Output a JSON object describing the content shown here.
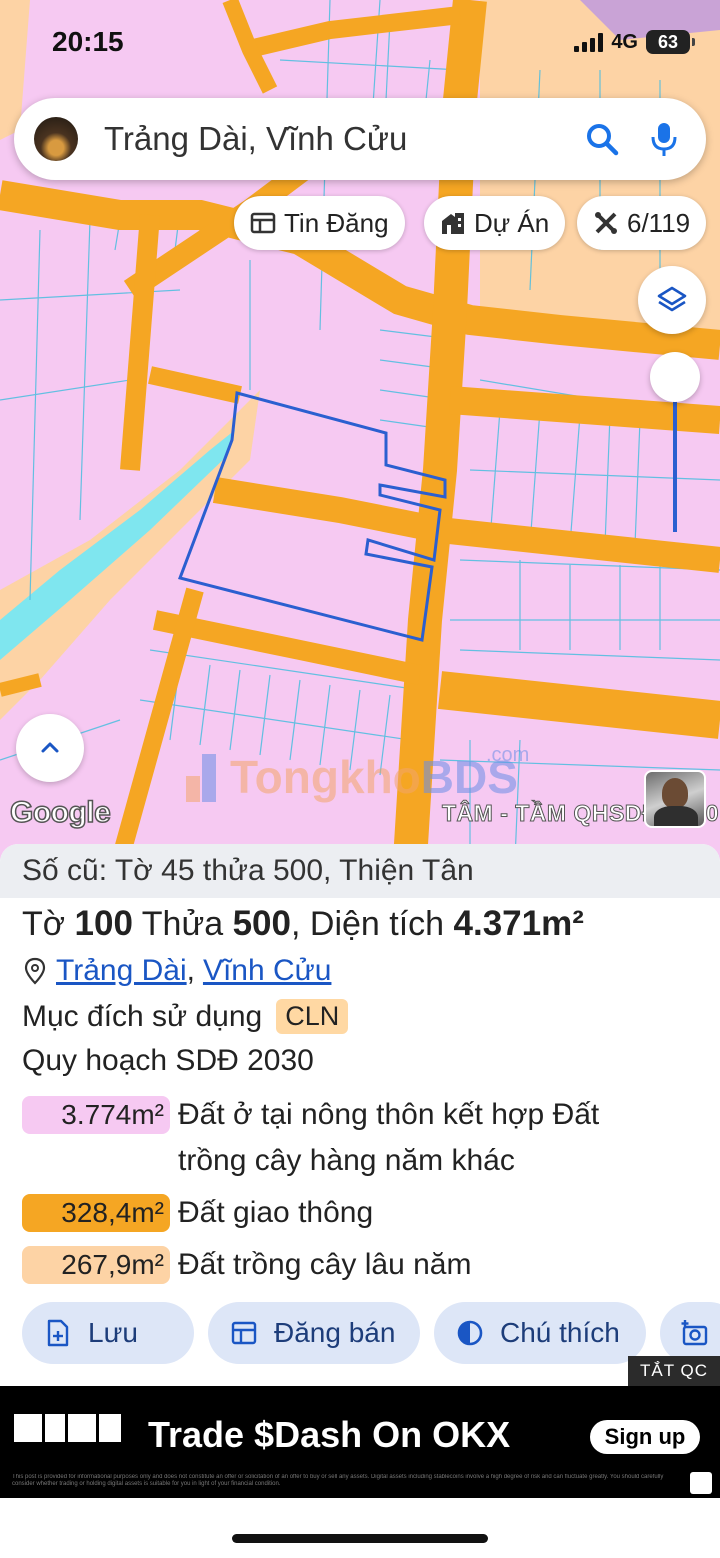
{
  "status_bar": {
    "time": "20:15",
    "network": "4G",
    "battery": "63"
  },
  "search": {
    "text": "Trảng Dài, Vĩnh Cửu"
  },
  "chips": {
    "listings": "Tin Đăng",
    "projects": "Dự Án",
    "count": "6/119"
  },
  "map": {
    "google_label": "Google",
    "watermark_left": "Tongkho",
    "watermark_right": "BDS",
    "watermark_suffix": ".com",
    "layer_label": "TÂM - TẦM QHSDĐ 2030",
    "colors": {
      "residential": "#f6c9f2",
      "road": "#f5a623",
      "perennial": "#fdd3a5",
      "water": "#7fe6ef",
      "parcel": "#2b5fd0"
    }
  },
  "parcel": {
    "old_info": "Số cũ: Tờ 45 thửa 500, Thiện Tân",
    "sheet_label": "Tờ",
    "sheet_number": "100",
    "lot_label": "Thửa",
    "lot_number": "500",
    "area_label": ", Diện tích",
    "area_value": "4.371m²",
    "ward": "Trảng Dài",
    "separator": ",",
    "district": "Vĩnh Cửu",
    "purpose_label": "Mục đích sử dụng",
    "purpose_code": "CLN",
    "plan_title": "Quy hoạch SDĐ 2030",
    "plan": [
      {
        "area": "3.774m²",
        "label": "Đất ở tại nông thôn kết hợp Đất trồng cây hàng năm khác",
        "color": "#f6c9f2"
      },
      {
        "area": "328,4m²",
        "label": "Đất giao thông",
        "color": "#f5a623"
      },
      {
        "area": "267,9m²",
        "label": "Đất trồng cây lâu năm",
        "color": "#fdd3a5"
      }
    ]
  },
  "actions": {
    "save": "Lưu",
    "sell": "Đăng bán",
    "legend": "Chú thích"
  },
  "ad": {
    "close_label": "TẮT QC",
    "title": "Trade $Dash On OKX",
    "cta": "Sign up",
    "fine_print": "This post is provided for informational purposes only and does not constitute an offer or solicitation of an offer to buy or sell any assets. Digital assets including stablecoins involve a high degree of risk and can fluctuate greatly. You should carefully consider whether trading or holding digital assets is suitable for you in light of your financial condition."
  }
}
